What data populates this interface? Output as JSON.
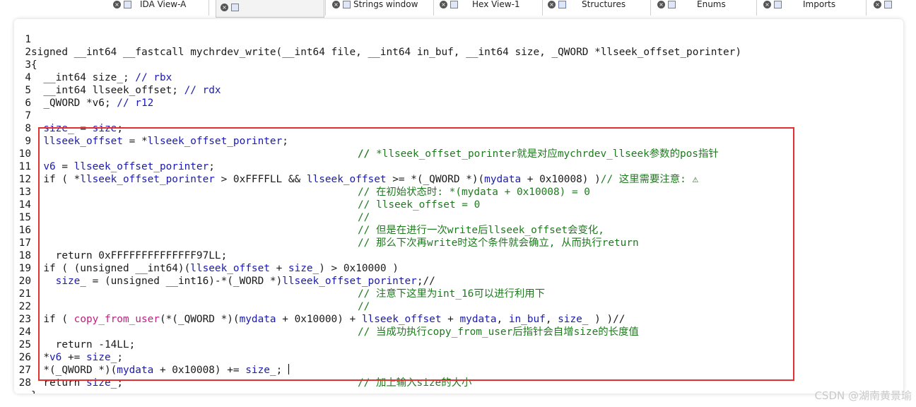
{
  "tabs": [
    {
      "label": "IDA View-A",
      "active": false
    },
    {
      "label": "",
      "active": true
    },
    {
      "label": "Strings window",
      "active": false
    },
    {
      "label": "Hex View-1",
      "active": false
    },
    {
      "label": "Structures",
      "active": false
    },
    {
      "label": "Enums",
      "active": false
    },
    {
      "label": "Imports",
      "active": false
    }
  ],
  "line_numbers": [
    "1",
    "2",
    "3",
    "4",
    "5",
    "6",
    "7",
    "8",
    "9",
    "10",
    "11",
    "12",
    "13",
    "14",
    "15",
    "16",
    "17",
    "18",
    "19",
    "20",
    "21",
    "22",
    "23",
    "24",
    "25",
    "26",
    "27",
    "28"
  ],
  "code": {
    "l1": "signed __int64 __fastcall mychrdev_write(__int64 file, __int64 in_buf, __int64 size, _QWORD *llseek_offset_porinter)",
    "l2": "{",
    "l3a": "  __int64 size_; ",
    "l3b": "// rbx",
    "l4a": "  __int64 llseek_offset; ",
    "l4b": "// rdx",
    "l5a": "  _QWORD *v6; ",
    "l5b": "// r12",
    "l7a": "  ",
    "l7b": "size_",
    "l7c": " = ",
    "l7d": "size",
    "l7e": ";",
    "l8a": "  ",
    "l8b": "llseek_offset",
    "l8c": " = *",
    "l8d": "llseek_offset_porinter",
    "l8e": ";      ",
    "l8f": "// *llseek_offset_porinter就是对应mychrdev_llseek参数的pos指针",
    "l9": "//",
    "l10a": "  ",
    "l10b": "v6",
    "l10c": " = ",
    "l10d": "llseek_offset_porinter",
    "l10e": ";",
    "l11a": "  if ( *",
    "l11b": "llseek_offset_porinter",
    "l11c": " > 0xFFFFLL && ",
    "l11d": "llseek_offset",
    "l11e": " >= *(_QWORD *)(",
    "l11f": "mydata",
    "l11g": " + 0x10008) )",
    "l11h": "// 这里需要注意: ⚠",
    "l12": "// 在初始状态时: *(mydata + 0x10008) = 0",
    "l13": "// llseek_offset = 0",
    "l14": "//",
    "l15": "// 但是在进行一次write后llseek_offset会变化,",
    "l16": "// 那么下次再write时这个条件就会确立, 从而执行return",
    "l17": "    return 0xFFFFFFFFFFFFFF97LL;",
    "l18a": "  if ( (unsigned __int64)(",
    "l18b": "llseek_offset",
    "l18c": " + ",
    "l18d": "size_",
    "l18e": ") > 0x10000 )",
    "l19a": "    ",
    "l19b": "size_",
    "l19c": " = (unsigned __int16)-*(_WORD *)",
    "l19d": "llseek_offset_porinter",
    "l19e": ";//",
    "l20": "// 注意下这里为int_16可以进行利用下",
    "l21": "//",
    "l22a": "  if ( ",
    "l22b": "copy_from_user",
    "l22c": "(*(_QWORD *)(",
    "l22d": "mydata",
    "l22e": " + 0x10000) + ",
    "l22f": "llseek_offset",
    "l22g": " + ",
    "l22h": "mydata",
    "l22i": ", ",
    "l22j": "in_buf",
    "l22k": ", ",
    "l22l": "size_",
    "l22m": " ) )//",
    "l23": "// 当成功执行copy_from_user后指针会自增size的长度值",
    "l24": "    return -14LL;",
    "l25a": "  *",
    "l25b": "v6",
    "l25c": " += ",
    "l25d": "size_",
    "l25e": ";",
    "l26a": "  *(_QWORD *)(",
    "l26b": "mydata",
    "l26c": " + 0x10008) += ",
    "l26d": "size_",
    "l26e": "; ",
    "l26f": "// 加上输入size的大小",
    "l27a": "  return ",
    "l27b": "size_",
    "l27c": ";",
    "l28": "}"
  },
  "watermark": "CSDN @湖南黄景瑜",
  "colors": {
    "variable": "#1a1ab0",
    "comment": "#1f7a1f",
    "function": "#c0207f",
    "highlight_box": "#e03030"
  }
}
